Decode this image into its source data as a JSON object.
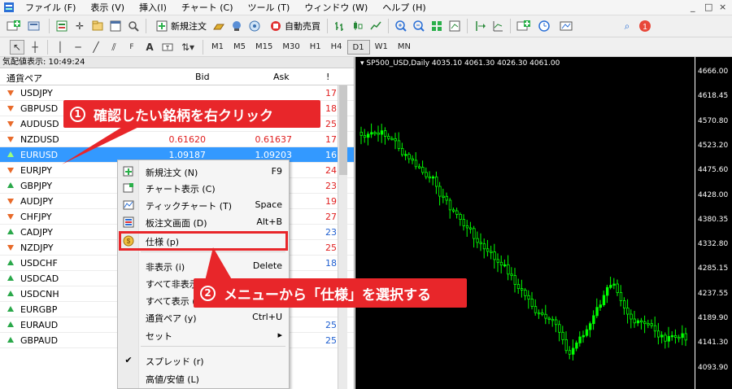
{
  "menubar": {
    "items": [
      "ファイル (F)",
      "表示 (V)",
      "挿入(I)",
      "チャート (C)",
      "ツール (T)",
      "ウィンドウ (W)",
      "ヘルプ (H)"
    ],
    "window_controls": [
      "_",
      "□",
      "×"
    ]
  },
  "toolbar": {
    "new_order": "新規注文",
    "auto_trade": "自動売買",
    "notification_count": "1",
    "timeframes": [
      "M1",
      "M5",
      "M15",
      "M30",
      "H1",
      "H4",
      "D1",
      "W1",
      "MN"
    ],
    "active_timeframe": "D1"
  },
  "market_watch": {
    "title": "気配値表示: 10:49:24",
    "headers": {
      "symbol": "通貨ペア",
      "bid": "Bid",
      "ask": "Ask",
      "spread": "!"
    },
    "rows": [
      {
        "symbol": "USDJPY",
        "bid": "",
        "ask": "",
        "spread": "17",
        "dir": "down",
        "color": "red"
      },
      {
        "symbol": "GBPUSD",
        "bid": "",
        "ask": "",
        "spread": "18",
        "dir": "down",
        "color": "red"
      },
      {
        "symbol": "AUDUSD",
        "bid": "",
        "ask": "",
        "spread": "25",
        "dir": "down",
        "color": "red"
      },
      {
        "symbol": "NZDUSD",
        "bid": "0.61620",
        "ask": "0.61637",
        "spread": "17",
        "dir": "down",
        "color": "red"
      },
      {
        "symbol": "EURUSD",
        "bid": "1.09187",
        "ask": "1.09203",
        "spread": "16",
        "dir": "up",
        "color": "sel"
      },
      {
        "symbol": "EURJPY",
        "bid": "",
        "ask": "",
        "spread": "24",
        "dir": "down",
        "color": "red"
      },
      {
        "symbol": "GBPJPY",
        "bid": "",
        "ask": "",
        "spread": "23",
        "dir": "up",
        "color": "red"
      },
      {
        "symbol": "AUDJPY",
        "bid": "",
        "ask": "",
        "spread": "19",
        "dir": "down",
        "color": "red"
      },
      {
        "symbol": "CHFJPY",
        "bid": "",
        "ask": "",
        "spread": "27",
        "dir": "down",
        "color": "red"
      },
      {
        "symbol": "CADJPY",
        "bid": "",
        "ask": "",
        "spread": "23",
        "dir": "up",
        "color": "blue"
      },
      {
        "symbol": "NZDJPY",
        "bid": "",
        "ask": "",
        "spread": "25",
        "dir": "down",
        "color": "red"
      },
      {
        "symbol": "USDCHF",
        "bid": "",
        "ask": "",
        "spread": "18",
        "dir": "up",
        "color": "blue"
      },
      {
        "symbol": "USDCAD",
        "bid": "",
        "ask": "",
        "spread": "",
        "dir": "up",
        "color": "blue"
      },
      {
        "symbol": "USDCNH",
        "bid": "",
        "ask": "",
        "spread": "",
        "dir": "up",
        "color": "blue"
      },
      {
        "symbol": "EURGBP",
        "bid": "",
        "ask": "",
        "spread": "",
        "dir": "up",
        "color": "blue"
      },
      {
        "symbol": "EURAUD",
        "bid": "",
        "ask": "",
        "spread": "25",
        "dir": "up",
        "color": "blue"
      },
      {
        "symbol": "GBPAUD",
        "bid": "",
        "ask": "",
        "spread": "25",
        "dir": "up",
        "color": "blue"
      }
    ]
  },
  "context_menu": {
    "items": [
      {
        "label": "新規注文 (N)",
        "shortcut": "F9",
        "icon": "new-order-icon"
      },
      {
        "label": "チャート表示 (C)",
        "shortcut": "",
        "icon": "chart-window-icon"
      },
      {
        "label": "ティックチャート (T)",
        "shortcut": "Space",
        "icon": "tick-chart-icon"
      },
      {
        "label": "板注文画面 (D)",
        "shortcut": "Alt+B",
        "icon": "depth-of-market-icon"
      },
      {
        "label": "仕様 (p)",
        "shortcut": "",
        "icon": "specification-icon"
      },
      {
        "label": "非表示 (i)",
        "shortcut": "Delete",
        "icon": ""
      },
      {
        "label": "すべて非表示",
        "shortcut": "",
        "icon": ""
      },
      {
        "label": "すべて表示 (S",
        "shortcut": "",
        "icon": ""
      },
      {
        "label": "通貨ペア (y)",
        "shortcut": "Ctrl+U",
        "icon": ""
      },
      {
        "label": "セット",
        "shortcut": "▸",
        "icon": ""
      },
      {
        "label": "スプレッド (r)",
        "shortcut": "",
        "icon": "check-icon"
      },
      {
        "label": "高値/安値 (L)",
        "shortcut": "",
        "icon": ""
      }
    ]
  },
  "chart": {
    "title": "SP500_USD,Daily  4035.10 4061.30 4026.30 4061.00",
    "price_labels": [
      "4666.00",
      "4618.45",
      "4570.80",
      "4523.20",
      "4475.60",
      "4428.00",
      "4380.35",
      "4332.80",
      "4285.15",
      "4237.55",
      "4189.90",
      "4141.30",
      "4093.90"
    ],
    "colors": {
      "bull": "#00ff00",
      "bear": "#00ff00",
      "bg": "#000000"
    }
  },
  "callouts": {
    "step1_num": "1",
    "step1": "確認したい銘柄を右クリック",
    "step2_num": "2",
    "step2": "メニューから「仕様」を選択する"
  },
  "colors": {
    "accent": "#e8262a",
    "selection": "#3399ff",
    "down": "#e02020",
    "up": "#1f5fd0"
  }
}
